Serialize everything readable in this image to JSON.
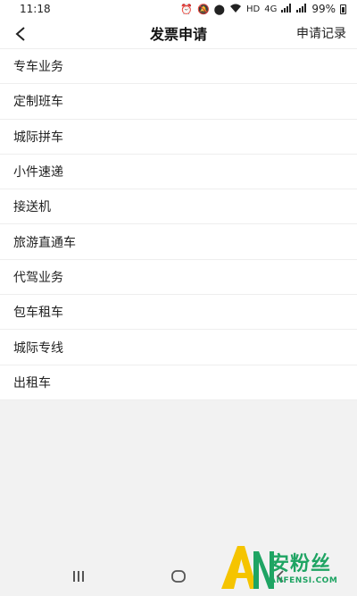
{
  "status_bar": {
    "time": "11:18",
    "battery": "99%",
    "network_label": "HD",
    "signal_label": "4G"
  },
  "header": {
    "title": "发票申请",
    "records_label": "申请记录"
  },
  "services": [
    "专车业务",
    "定制班车",
    "城际拼车",
    "小件速递",
    "接送机",
    "旅游直通车",
    "代驾业务",
    "包车租车",
    "城际专线",
    "出租车"
  ],
  "watermark": {
    "brand_cn": "安粉丝",
    "brand_en": "ANFENSI.COM",
    "color": "#1fa463"
  },
  "colors": {
    "background": "#f2f2f2",
    "surface": "#ffffff",
    "divider": "#eeeeee"
  }
}
